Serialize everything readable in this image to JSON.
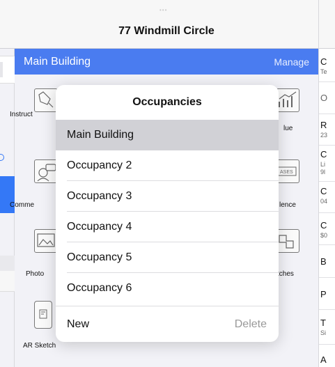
{
  "header": {
    "title": "77 Windmill Circle",
    "grabber": "•••"
  },
  "bar": {
    "title": "Main Building",
    "manage": "Manage"
  },
  "tiles": [
    {
      "label": "Instruct",
      "icon": "instructions-icon"
    },
    {
      "label": "lue",
      "icon": "value-chart-icon"
    },
    {
      "label": "Comme",
      "icon": "comments-icon"
    },
    {
      "label": "lence",
      "icon": "evidence-icon"
    },
    {
      "label": "Photo",
      "icon": "photos-icon"
    },
    {
      "label": "tches",
      "icon": "sketches-icon"
    },
    {
      "label": "AR Sketch",
      "icon": "ar-sketch-icon"
    }
  ],
  "right_col": [
    {
      "big": "C",
      "small": "Te"
    },
    {
      "big": "O",
      "small": ""
    },
    {
      "big": "R",
      "small": "23"
    },
    {
      "big": "C",
      "small": "Li"
    },
    {
      "big": "",
      "small": "9l"
    },
    {
      "big": "C",
      "small": "04"
    },
    {
      "big": "C",
      "small": "$0"
    },
    {
      "big": "B",
      "small": ""
    },
    {
      "big": "P",
      "small": ""
    },
    {
      "big": "T",
      "small": "Si"
    },
    {
      "big": "A",
      "small": ""
    }
  ],
  "popover": {
    "title": "Occupancies",
    "items": [
      {
        "label": "Main Building",
        "selected": true
      },
      {
        "label": "Occupancy 2"
      },
      {
        "label": "Occupancy 3"
      },
      {
        "label": "Occupancy 4"
      },
      {
        "label": "Occupancy 5"
      },
      {
        "label": "Occupancy 6"
      }
    ],
    "new_label": "New",
    "delete_label": "Delete"
  }
}
